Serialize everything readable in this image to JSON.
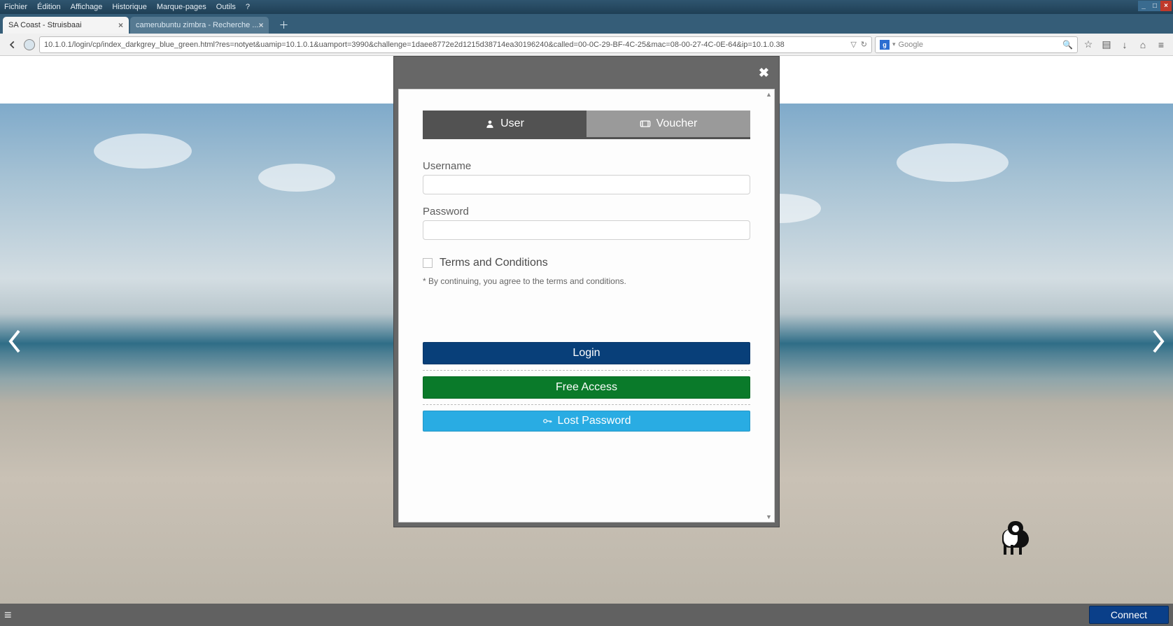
{
  "menu": {
    "items": [
      "Fichier",
      "Édition",
      "Affichage",
      "Historique",
      "Marque-pages",
      "Outils",
      "?"
    ]
  },
  "tabs": {
    "active": {
      "title": "SA Coast - Struisbaai"
    },
    "inactive": {
      "title": "camerubuntu zimbra - Recherche ..."
    }
  },
  "toolbar": {
    "url": "10.1.0.1/login/cp/index_darkgrey_blue_green.html?res=notyet&uamip=10.1.0.1&uamport=3990&challenge=1daee8772e2d1215d38714ea30196240&called=00-0C-29-BF-4C-25&mac=08-00-27-4C-0E-64&ip=10.1.0.38",
    "search_placeholder": "Google"
  },
  "modal": {
    "tab_user": "User",
    "tab_voucher": "Voucher",
    "username_label": "Username",
    "password_label": "Password",
    "tc_label": "Terms and Conditions",
    "tc_note": "* By continuing, you agree to the terms and conditions.",
    "login_btn": "Login",
    "free_btn": "Free Access",
    "lost_btn": "Lost Password"
  },
  "bottom": {
    "connect": "Connect"
  }
}
